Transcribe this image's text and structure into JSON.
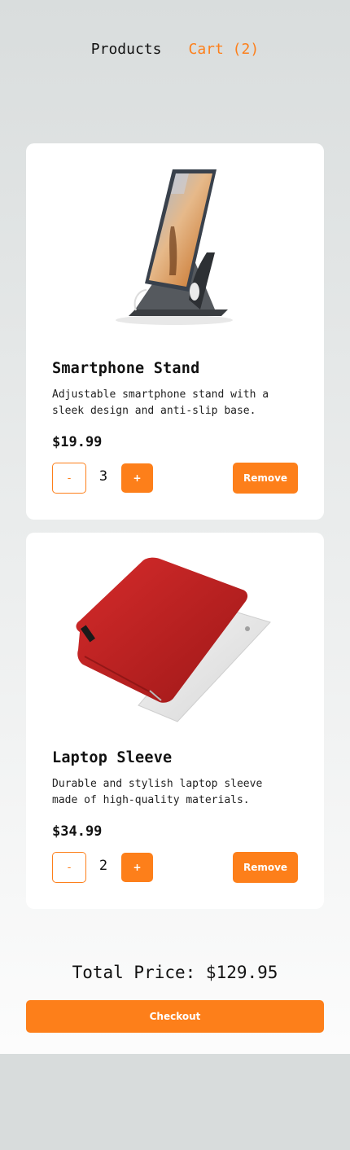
{
  "nav": {
    "products_label": "Products",
    "cart_label": "Cart (2)"
  },
  "cart_items": [
    {
      "title": "Smartphone Stand",
      "description": "Adjustable smartphone stand with a sleek design and anti-slip base.",
      "price": "$19.99",
      "quantity": "3",
      "minus_label": "-",
      "plus_label": "+",
      "remove_label": "Remove",
      "image_icon": "smartphone-stand-image"
    },
    {
      "title": "Laptop Sleeve",
      "description": "Durable and stylish laptop sleeve made of high-quality materials.",
      "price": "$34.99",
      "quantity": "2",
      "minus_label": "-",
      "plus_label": "+",
      "remove_label": "Remove",
      "image_icon": "laptop-sleeve-image"
    }
  ],
  "summary": {
    "total_text": "Total Price: $129.95",
    "checkout_label": "Checkout"
  },
  "colors": {
    "accent": "#fd7f1a",
    "background": "#d9dddd",
    "card": "#ffffff"
  }
}
